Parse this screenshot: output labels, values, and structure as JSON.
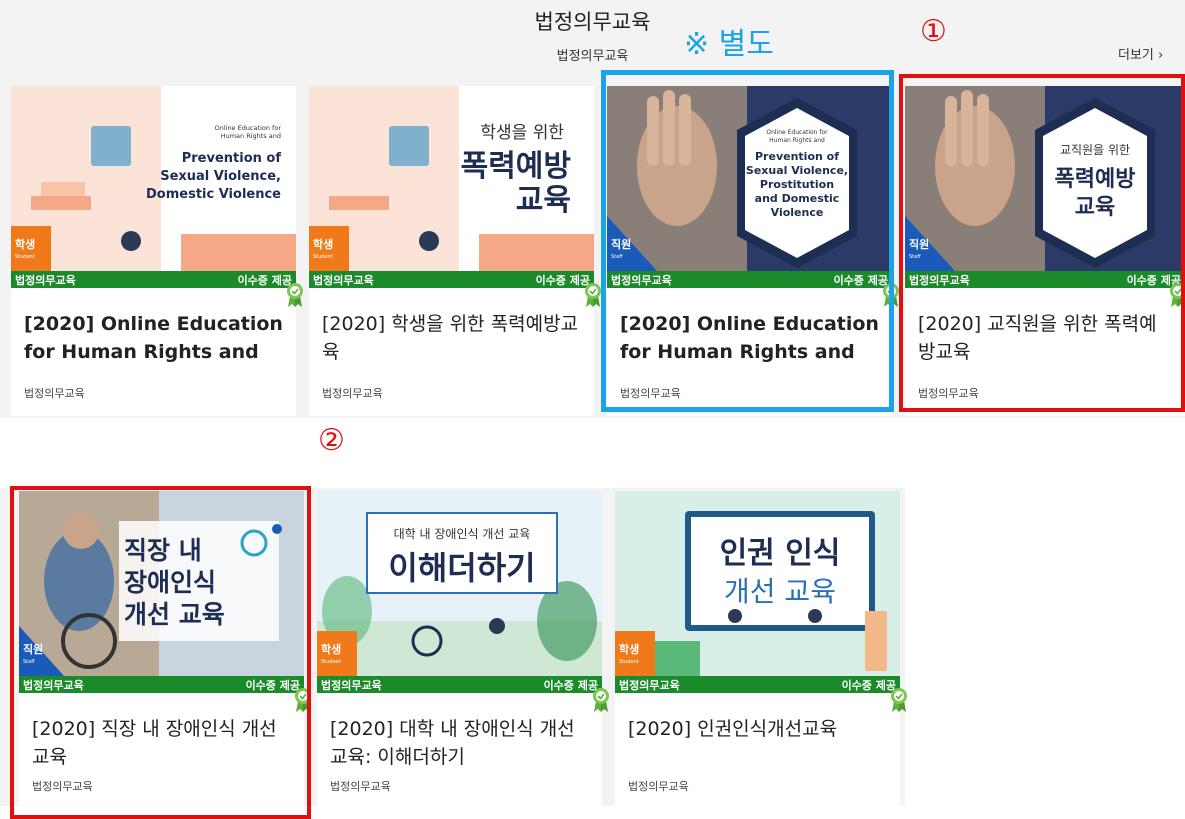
{
  "section": {
    "title": "법정의무교육",
    "subtitle": "법정의무교육",
    "more_label": "더보기 ›"
  },
  "annotations": {
    "separate": "※ 별도",
    "num1": "①",
    "num2": "②"
  },
  "colors": {
    "bar_green": "#1a8a2a",
    "highlight_blue": "#1aa3e8",
    "highlight_red": "#e01010",
    "student_orange": "#f07a1a",
    "staff_blue": "#1a5ab8"
  },
  "cards": [
    {
      "category_bar": "법정의무교육",
      "cert_label": "이수증 제공",
      "title": "[2020] Online Education for Human Rights and",
      "category": "법정의무교육",
      "audience": "학생",
      "audience_en": "Student",
      "thumb_lines": [
        "Online Education for",
        "Human Rights and",
        "Prevention of",
        "Sexual Violence,",
        "Domestic Violence"
      ]
    },
    {
      "category_bar": "법정의무교육",
      "cert_label": "이수증 제공",
      "title": "[2020] 학생을 위한 폭력예방교육",
      "category": "법정의무교육",
      "audience": "학생",
      "audience_en": "Student",
      "thumb_lines": [
        "학생을 위한",
        "폭력예방",
        "교육"
      ]
    },
    {
      "category_bar": "법정의무교육",
      "cert_label": "이수증 제공",
      "title": "[2020] Online Education for Human Rights and",
      "category": "법정의무교육",
      "audience": "직원",
      "audience_en": "Staff",
      "thumb_lines": [
        "Online Education for",
        "Human Rights and",
        "Prevention of",
        "Sexual Violence,",
        "Prostitution",
        "and Domestic",
        "Violence"
      ]
    },
    {
      "category_bar": "법정의무교육",
      "cert_label": "이수증 제공",
      "title": "[2020] 교직원을 위한 폭력예방교육",
      "category": "법정의무교육",
      "audience": "직원",
      "audience_en": "Staff",
      "thumb_lines": [
        "교직원을 위한",
        "폭력예방",
        "교육"
      ]
    },
    {
      "category_bar": "법정의무교육",
      "cert_label": "이수증 제공",
      "title": "[2020] 직장 내 장애인식 개선교육",
      "category": "법정의무교육",
      "audience": "직원",
      "audience_en": "Staff",
      "thumb_lines": [
        "직장 내",
        "장애인식",
        "개선 교육"
      ]
    },
    {
      "category_bar": "법정의무교육",
      "cert_label": "이수증 제공",
      "title": "[2020] 대학 내 장애인식 개선교육: 이해더하기",
      "category": "법정의무교육",
      "audience": "학생",
      "audience_en": "Student",
      "thumb_lines": [
        "대학 내 장애인식 개선 교육",
        "이해더하기"
      ]
    },
    {
      "category_bar": "법정의무교육",
      "cert_label": "이수증 제공",
      "title": "[2020] 인권인식개선교육",
      "category": "법정의무교육",
      "audience": "학생",
      "audience_en": "Student",
      "thumb_lines": [
        "인권 인식",
        "개선 교육"
      ]
    }
  ]
}
